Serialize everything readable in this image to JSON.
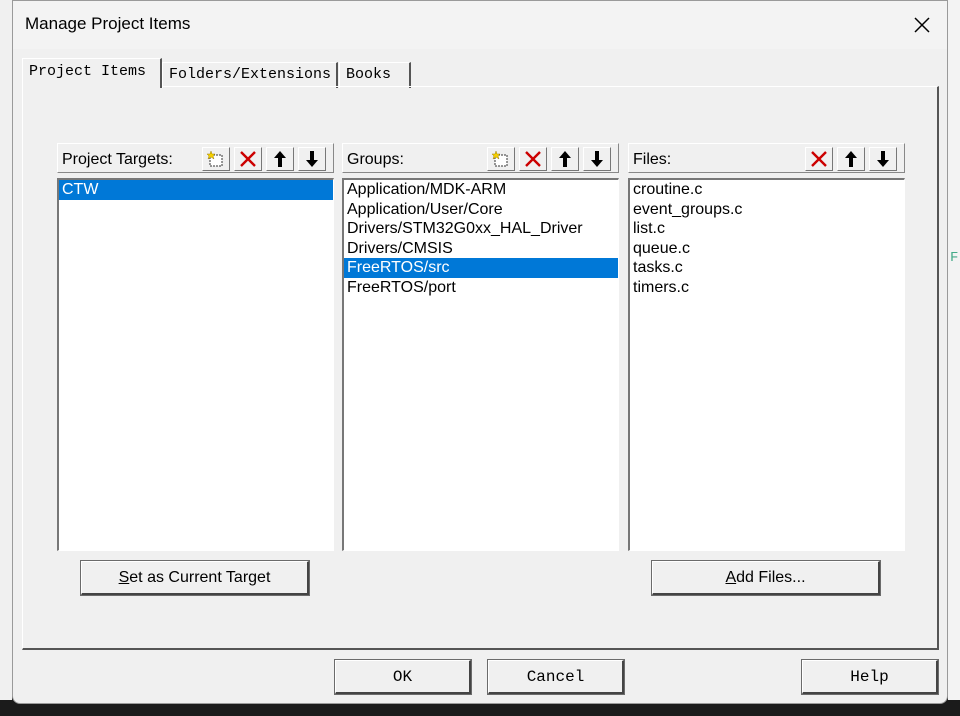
{
  "dialog": {
    "title": "Manage Project Items"
  },
  "tabs": [
    {
      "label": "Project Items",
      "active": true
    },
    {
      "label": "Folders/Extensions",
      "active": false
    },
    {
      "label": "Books",
      "active": false
    }
  ],
  "targets": {
    "header": "Project Targets:",
    "items": [
      "CTW"
    ],
    "selected_index": 0
  },
  "groups": {
    "header": "Groups:",
    "items": [
      "Application/MDK-ARM",
      "Application/User/Core",
      "Drivers/STM32G0xx_HAL_Driver",
      "Drivers/CMSIS",
      "FreeRTOS/src",
      "FreeRTOS/port"
    ],
    "selected_index": 4
  },
  "files": {
    "header": "Files:",
    "items": [
      "croutine.c",
      "event_groups.c",
      "list.c",
      "queue.c",
      "tasks.c",
      "timers.c"
    ]
  },
  "buttons": {
    "set_current_target_u": "S",
    "set_current_target_rest": "et as Current Target",
    "add_files_u": "A",
    "add_files_rest": "dd Files...",
    "ok": "OK",
    "cancel": "Cancel",
    "help": "Help"
  },
  "background": {
    "right_edge_text": "F"
  },
  "colors": {
    "selection": "#0078d7",
    "delete_icon": "#cc0000",
    "new_icon_yellow": "#f5d000"
  }
}
